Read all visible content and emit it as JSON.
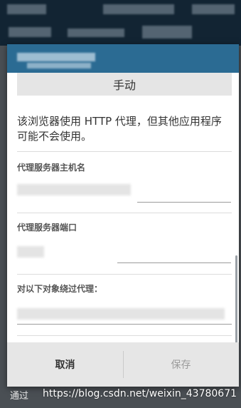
{
  "dialog": {
    "manual_button_label": "手动",
    "info_text": "该浏览器使用 HTTP 代理，但其他应用程序可能不会使用。",
    "hostname_label": "代理服务器主机名",
    "port_label": "代理服务器端口",
    "bypass_label": "对以下对象绕过代理：",
    "cancel_label": "取消",
    "save_label": "保存"
  },
  "background": {
    "bottom_text": "通过"
  },
  "watermark": "https://blog.csdn.net/weixin_43780671",
  "colors": {
    "titlebar": "#2b6b93",
    "save_disabled": "#9b9b9b",
    "cancel": "#333333"
  }
}
